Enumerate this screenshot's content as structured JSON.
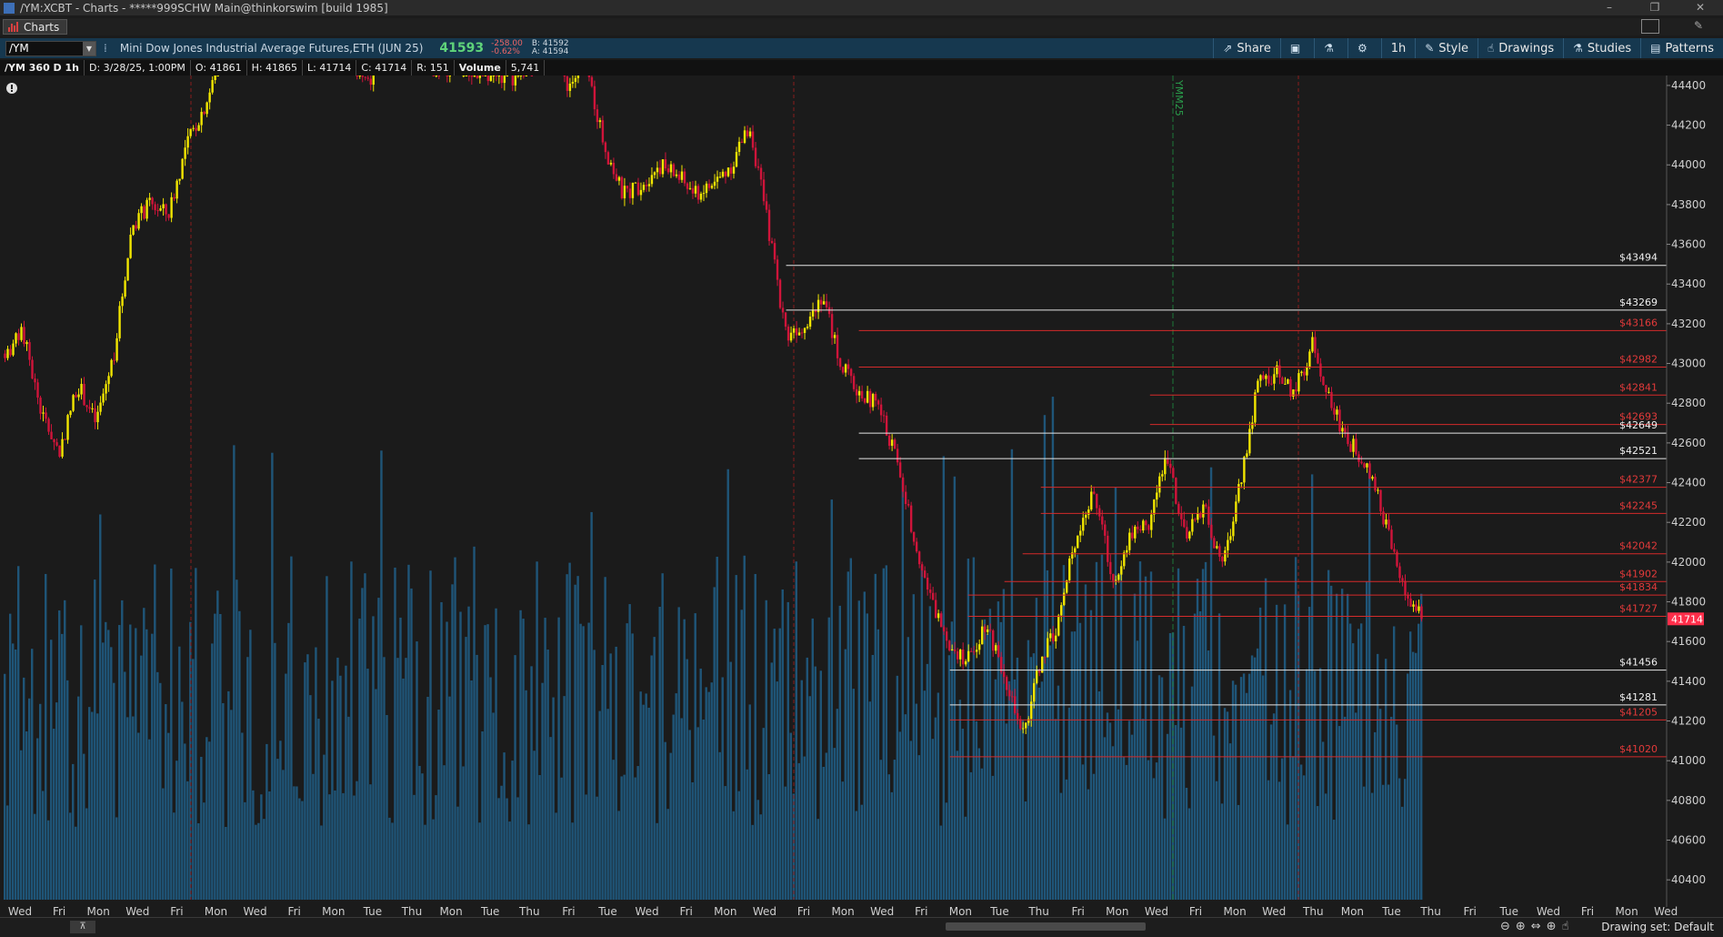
{
  "window": {
    "title": "/YM:XCBT - Charts - *****999SCHW Main@thinkorswim [build 1985]",
    "controls": [
      "–",
      "❐",
      "✕"
    ]
  },
  "tab": {
    "label": "Charts"
  },
  "toolbar": {
    "symbol": "/YM",
    "description": "Mini Dow Jones Industrial Average Futures,ETH (JUN 25)",
    "last": "41593",
    "net_change": "-258.00",
    "pct_change": "-0.62%",
    "bid": "B: 41592",
    "ask": "A: 41594",
    "buttons": {
      "share": "Share",
      "timeframe": "1h",
      "style": "Style",
      "drawings": "Drawings",
      "studies": "Studies",
      "patterns": "Patterns"
    }
  },
  "infobar": {
    "period": "/YM 360 D 1h",
    "date": "D: 3/28/25, 1:00PM",
    "open": "O: 41861",
    "high": "H: 41865",
    "low": "L: 41714",
    "close": "C: 41714",
    "range": "R: 151",
    "volume_label": "Volume",
    "volume_value": "5,741"
  },
  "status": {
    "drawing_set": "Drawing set: Default"
  },
  "colors": {
    "up": "#f2e600",
    "down": "#d0143a",
    "volume": "#1f5578",
    "level_white": "#e6e6e6",
    "level_red": "#d42b2b",
    "current": "#ff2e4a",
    "background": "#1b1b1b"
  },
  "chart_data": {
    "type": "candlestick",
    "ylim": [
      40300,
      44450
    ],
    "y_ticks": [
      40400,
      40600,
      40800,
      41000,
      41200,
      41400,
      41600,
      41800,
      42000,
      42200,
      42400,
      42600,
      42800,
      43000,
      43200,
      43400,
      43600,
      43800,
      44000,
      44200,
      44400
    ],
    "x_ticks": [
      "Wed",
      "Fri",
      "Mon",
      "Wed",
      "Fri",
      "Mon",
      "Wed",
      "Fri",
      "Mon",
      "Tue",
      "Thu",
      "Mon",
      "Tue",
      "Thu",
      "Fri",
      "Tue",
      "Wed",
      "Fri",
      "Mon",
      "Wed",
      "Fri",
      "Mon",
      "Wed",
      "Fri",
      "Mon",
      "Tue",
      "Thu",
      "Fri",
      "Mon",
      "Wed",
      "Fri",
      "Mon",
      "Wed",
      "Thu",
      "Mon",
      "Tue",
      "Thu",
      "Fri",
      "Tue",
      "Wed",
      "Fri",
      "Mon",
      "Wed",
      "Thu"
    ],
    "current_price": 41714,
    "vertical_marker_label": "YMM25",
    "price_levels": [
      {
        "value": 43494,
        "label": "$43494",
        "color": "white",
        "from": 43
      },
      {
        "value": 43269,
        "label": "$43269",
        "color": "white",
        "from": 43
      },
      {
        "value": 43166,
        "label": "$43166",
        "color": "red",
        "from": 47
      },
      {
        "value": 42982,
        "label": "$42982",
        "color": "red",
        "from": 47
      },
      {
        "value": 42841,
        "label": "$42841",
        "color": "red",
        "from": 63
      },
      {
        "value": 42693,
        "label": "$42693",
        "color": "red",
        "from": 63
      },
      {
        "value": 42649,
        "label": "$42649",
        "color": "white",
        "from": 47
      },
      {
        "value": 42521,
        "label": "$42521",
        "color": "white",
        "from": 47
      },
      {
        "value": 42377,
        "label": "$42377",
        "color": "red",
        "from": 57
      },
      {
        "value": 42245,
        "label": "$42245",
        "color": "red",
        "from": 57
      },
      {
        "value": 42042,
        "label": "$42042",
        "color": "red",
        "from": 56
      },
      {
        "value": 41902,
        "label": "$41902",
        "color": "red",
        "from": 55
      },
      {
        "value": 41834,
        "label": "$41834",
        "color": "red",
        "from": 53
      },
      {
        "value": 41727,
        "label": "$41727",
        "color": "red",
        "from": 53
      },
      {
        "value": 41456,
        "label": "$41456",
        "color": "white",
        "from": 52
      },
      {
        "value": 41281,
        "label": "$41281",
        "color": "white",
        "from": 52
      },
      {
        "value": 41205,
        "label": "$41205",
        "color": "red",
        "from": 52
      },
      {
        "value": 41020,
        "label": "$41020",
        "color": "red",
        "from": 52
      }
    ],
    "series": [
      {
        "name": "/YM close",
        "values": [
          43050,
          43150,
          42750,
          42550,
          42900,
          42700,
          43050,
          43700,
          43800,
          43750,
          44100,
          44300,
          44550,
          44600,
          44650,
          44600,
          44580,
          44560,
          44550,
          44500,
          44400,
          44560,
          44540,
          44520,
          44500,
          44480,
          44460,
          44450,
          44420,
          44500,
          44600,
          44400,
          44500,
          44100,
          43850,
          43900,
          44000,
          43950,
          43850,
          43900,
          44000,
          44200,
          43700,
          43150,
          43200,
          43350,
          43000,
          42850,
          42800,
          42550,
          42150,
          41800,
          41600,
          41500,
          41700,
          41450,
          41100,
          41500,
          41700,
          42150,
          42350,
          41900,
          42150,
          42200,
          42550,
          42100,
          42300,
          41950,
          42400,
          42900,
          42950,
          42850,
          43100,
          42800,
          42600,
          42500,
          42200,
          41850,
          41714
        ]
      }
    ]
  }
}
